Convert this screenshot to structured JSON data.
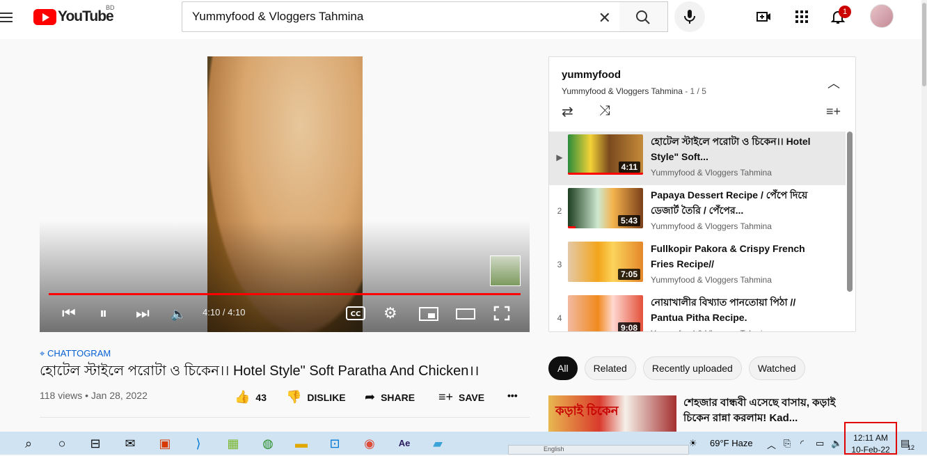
{
  "header": {
    "logo_text": "YouTube",
    "country": "BD",
    "search_value": "Yummyfood & Vloggers Tahmina",
    "notifications_count": "1"
  },
  "player": {
    "time": "4:10 / 4:10",
    "progress": 1.0
  },
  "video": {
    "location": "CHATTOGRAM",
    "title": "হোটেল স্টাইলে পরোটা ও চিকেন।। Hotel Style\" Soft Paratha And Chicken।।",
    "views": "118 views • Jan 28, 2022",
    "likes": "43",
    "dislike_label": "DISLIKE",
    "share_label": "SHARE",
    "save_label": "SAVE",
    "more": "•••"
  },
  "playlist": {
    "name": "yummyfood",
    "channel": "Yummyfood & Vloggers Tahmina",
    "position": "- 1 / 5",
    "items": [
      {
        "num": "▶",
        "title": "হোটেল স্টাইলে পরোটা ও চিকেন।। Hotel Style\" Soft...",
        "channel": "Yummyfood & Vloggers Tahmina",
        "duration": "4:11",
        "watched": 1.0
      },
      {
        "num": "2",
        "title": "Papaya Dessert Recipe / পেঁপে দিয়ে ডেজার্ট তৈরি / পেঁপের...",
        "channel": "Yummyfood & Vloggers Tahmina",
        "duration": "5:43",
        "watched": 0.1
      },
      {
        "num": "3",
        "title": "Fullkopir Pakora & Crispy French Fries Recipe//",
        "channel": "Yummyfood & Vloggers Tahmina",
        "duration": "7:05",
        "watched": 0
      },
      {
        "num": "4",
        "title": "নোয়াখালীর বিখ্যাত পানতোয়া পিঠা // Pantua Pitha Recipe.",
        "channel": "Yummyfood & Vloggers Tahmina",
        "duration": "9:08",
        "watched": 0
      }
    ]
  },
  "chips": [
    "All",
    "Related",
    "Recently uploaded",
    "Watched"
  ],
  "recommendation": {
    "title": "শেহজার বান্ধবী এসেছে বাসায়, কড়াই চিকেন রান্না করলাম! Kad...",
    "thumb_text": "কড়াই চিকেন"
  },
  "taskbar": {
    "weather": "69°F  Haze",
    "time": "12:11 AM",
    "date": "10-Feb-22",
    "notification_count": "12",
    "popup_text": "English"
  }
}
